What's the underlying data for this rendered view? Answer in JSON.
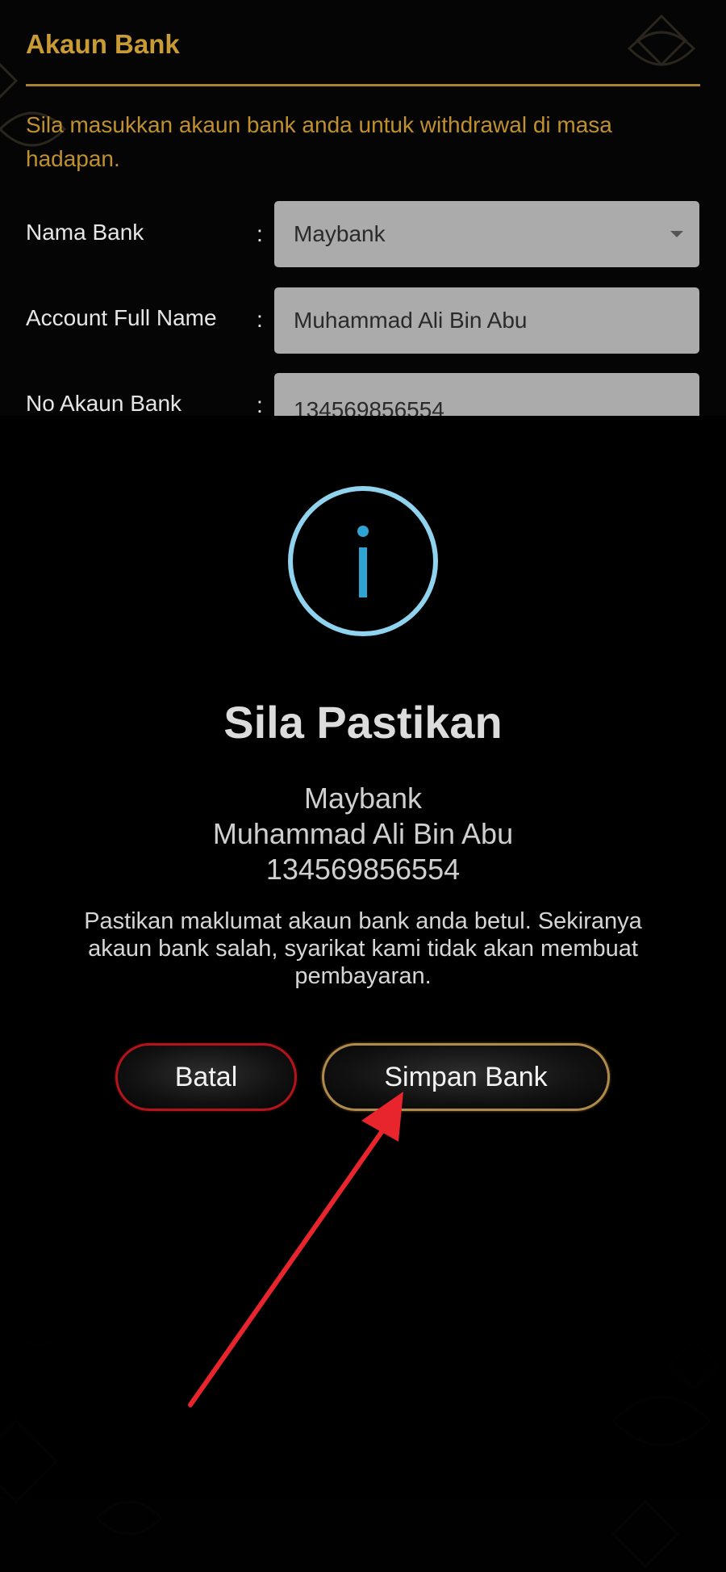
{
  "section": {
    "title": "Akaun Bank",
    "instruction": "Sila masukkan akaun bank anda untuk withdrawal di masa hadapan."
  },
  "form": {
    "fields": [
      {
        "label": "Nama Bank",
        "colon": ":",
        "value": "Maybank",
        "type": "select"
      },
      {
        "label": "Account Full Name",
        "colon": ":",
        "value": "Muhammad Ali Bin Abu",
        "type": "text"
      },
      {
        "label": "No Akaun Bank",
        "colon": ":",
        "value": "134569856554",
        "type": "text"
      }
    ]
  },
  "modal": {
    "icon": "info-icon",
    "title": "Sila Pastikan",
    "bank": "Maybank",
    "name": "Muhammad Ali Bin Abu",
    "account_no": "134569856554",
    "notice": "Pastikan maklumat akaun bank anda betul. Sekiranya akaun bank salah, syarikat kami tidak akan membuat pembayaran.",
    "cancel_label": "Batal",
    "save_label": "Simpan Bank"
  },
  "colors": {
    "accent_gold": "#c99b34",
    "info_blue": "#8fd3ee",
    "cancel_border": "#b3141c",
    "save_border": "#b08a4a",
    "annotation_arrow": "#e8242c"
  }
}
